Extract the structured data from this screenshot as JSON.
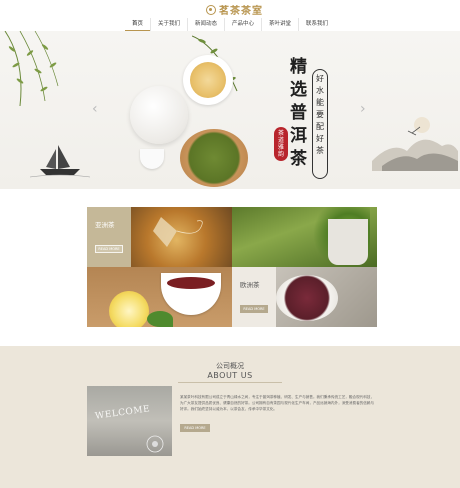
{
  "header": {
    "logo_text": "茗茶茶室",
    "nav": [
      {
        "label": "首页",
        "active": true
      },
      {
        "label": "关于我们",
        "active": false
      },
      {
        "label": "新闻动态",
        "active": false
      },
      {
        "label": "产品中心",
        "active": false
      },
      {
        "label": "茶叶讲堂",
        "active": false
      },
      {
        "label": "联系我们",
        "active": false
      }
    ]
  },
  "banner": {
    "title": "精选普洱茶",
    "slogan": [
      "好",
      "水",
      "能",
      "要",
      "配",
      "好",
      "茶"
    ],
    "seal": [
      "茶",
      "道",
      "雅",
      "韵"
    ],
    "prev_arrow": "‹",
    "next_arrow": "›"
  },
  "products": {
    "tile1": {
      "title": "亚洲茶",
      "more": "READ MORE"
    },
    "tile2": {
      "title": "欧洲茶",
      "more": "READ MORE"
    }
  },
  "about": {
    "title_cn": "公司概况",
    "title_en": "ABOUT US",
    "image_text": "WELCOME",
    "text": "某某茶叶科技有限公司成立于青山绿水之间，专注于普洱茶种植、研发、生产与销售。我们秉承传统工艺，融合现代科技，为广大茶友提供品质优良、健康自然的好茶。公司拥有自有茶园与现代化生产车间，产品远销海内外，深受消费者的信赖与好评。我们始终坚持以诚为本，以茶会友，传承中华茶文化。",
    "more": "READ MORE"
  },
  "colors": {
    "accent": "#b8954f",
    "about_bg": "#ece6da",
    "button": "#b5a98e",
    "seal": "#b8252c"
  }
}
